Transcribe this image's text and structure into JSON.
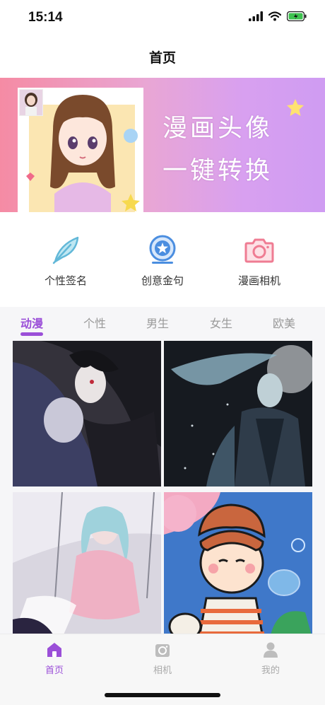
{
  "status_bar": {
    "time": "15:14"
  },
  "header": {
    "title": "首页"
  },
  "banner": {
    "line1": "漫画头像",
    "line2": "一键转换"
  },
  "features": [
    {
      "label": "个性签名",
      "icon": "feather-icon"
    },
    {
      "label": "创意金句",
      "icon": "star-badge-icon"
    },
    {
      "label": "漫画相机",
      "icon": "camera-icon"
    }
  ],
  "tabs": [
    {
      "label": "动漫",
      "active": true
    },
    {
      "label": "个性",
      "active": false
    },
    {
      "label": "男生",
      "active": false
    },
    {
      "label": "女生",
      "active": false
    },
    {
      "label": "欧美",
      "active": false
    }
  ],
  "gallery": [
    {
      "name": "dark-haired-couple-image"
    },
    {
      "name": "swordsman-image"
    },
    {
      "name": "swing-girl-image"
    },
    {
      "name": "bubble-boy-image"
    }
  ],
  "tabbar": [
    {
      "label": "首页",
      "icon": "home-icon",
      "active": true
    },
    {
      "label": "相机",
      "icon": "camera-icon",
      "active": false
    },
    {
      "label": "我的",
      "icon": "user-icon",
      "active": false
    }
  ],
  "colors": {
    "accent": "#9b4fd8",
    "banner_start": "#f58ba4",
    "banner_end": "#cf9cf2"
  }
}
